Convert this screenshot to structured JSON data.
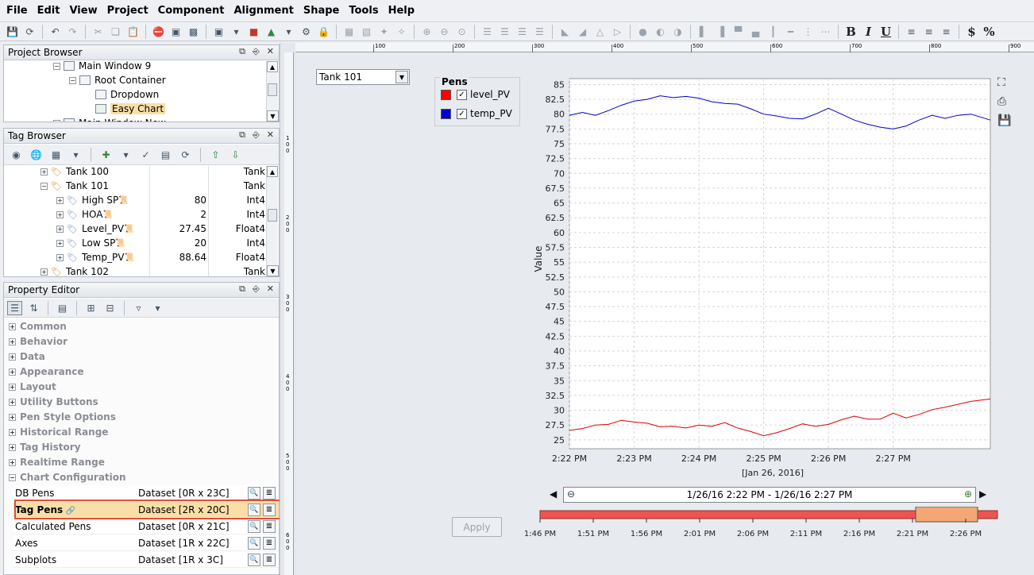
{
  "menu": [
    "File",
    "Edit",
    "View",
    "Project",
    "Component",
    "Alignment",
    "Shape",
    "Tools",
    "Help"
  ],
  "project_browser": {
    "title": "Project Browser",
    "items": [
      {
        "label": "Main Window 9",
        "level": 0,
        "icon": "window-icon"
      },
      {
        "label": "Root Container",
        "level": 1,
        "icon": "container-icon"
      },
      {
        "label": "Dropdown",
        "level": 2,
        "icon": "dropdown-icon"
      },
      {
        "label": "Easy Chart",
        "level": 2,
        "icon": "chart-icon",
        "selected": true
      },
      {
        "label": "Main Window New",
        "level": 0,
        "icon": "window-icon"
      }
    ]
  },
  "tag_browser": {
    "title": "Tag Browser",
    "rows": [
      {
        "label": "Tank 100",
        "value": "",
        "type": "Tank",
        "level": 0,
        "folder": true
      },
      {
        "label": "Tank 101",
        "value": "",
        "type": "Tank",
        "level": 0,
        "folder": true,
        "expanded": true
      },
      {
        "label": "High SP",
        "value": "80",
        "type": "Int4",
        "level": 1
      },
      {
        "label": "HOA",
        "value": "2",
        "type": "Int4",
        "level": 1
      },
      {
        "label": "Level_PV",
        "value": "27.45",
        "type": "Float4",
        "level": 1
      },
      {
        "label": "Low SP",
        "value": "20",
        "type": "Int4",
        "level": 1
      },
      {
        "label": "Temp_PV",
        "value": "88.64",
        "type": "Float4",
        "level": 1
      },
      {
        "label": "Tank 102",
        "value": "",
        "type": "Tank",
        "level": 0,
        "folder": true
      }
    ]
  },
  "property_editor": {
    "title": "Property Editor",
    "categories": [
      "Common",
      "Behavior",
      "Data",
      "Appearance",
      "Layout",
      "Utility Buttons",
      "Pen Style Options",
      "Historical Range",
      "Tag History",
      "Realtime Range"
    ],
    "open_category": "Chart Configuration",
    "properties": [
      {
        "name": "DB Pens",
        "value": "Dataset [0R x 23C]"
      },
      {
        "name": "Tag Pens",
        "value": "Dataset [2R x 20C]",
        "selected": true
      },
      {
        "name": "Calculated Pens",
        "value": "Dataset [0R x 21C]"
      },
      {
        "name": "Axes",
        "value": "Dataset [1R x 22C]"
      },
      {
        "name": "Subplots",
        "value": "Dataset [1R x 3C]"
      }
    ]
  },
  "ruler": {
    "h": [
      "100",
      "200",
      "300",
      "400",
      "500",
      "600",
      "700",
      "800",
      "900"
    ],
    "v": [
      "1\n0\n0",
      "2\n0\n0",
      "3\n0\n0",
      "4\n0\n0",
      "5\n0\n0",
      "6\n0\n0"
    ]
  },
  "dropdown": {
    "selected": "Tank 101"
  },
  "pens_legend": {
    "title": "Pens",
    "items": [
      {
        "name": "level_PV",
        "color": "#ff0000",
        "checked": true
      },
      {
        "name": "temp_PV",
        "color": "#0000cc",
        "checked": true
      }
    ]
  },
  "range_bar": {
    "text": "1/26/16 2:22 PM - 1/26/16 2:27 PM"
  },
  "apply_label": "Apply",
  "colors": {
    "selection_highlight": "#f9dfa7",
    "highlight_border": "#e34b3b",
    "overview_bar": "#ef5350",
    "overview_window": "#f4a774"
  },
  "chart_data": {
    "type": "line",
    "ylabel": "Value",
    "xlabel": "[Jan 26, 2016]",
    "ylim": [
      23.5,
      86
    ],
    "yticks": [
      25,
      27.5,
      30,
      32.5,
      35,
      37.5,
      40,
      42.5,
      45,
      47.5,
      50,
      52.5,
      55,
      57.5,
      60,
      62.5,
      65,
      67.5,
      70,
      72.5,
      75,
      77.5,
      80,
      82.5,
      85
    ],
    "xlim": [
      0,
      6.5
    ],
    "xticks": [
      {
        "label": "2:22 PM",
        "v": 0
      },
      {
        "label": "2:23 PM",
        "v": 1
      },
      {
        "label": "2:24 PM",
        "v": 2
      },
      {
        "label": "2:25 PM",
        "v": 3
      },
      {
        "label": "2:26 PM",
        "v": 4
      },
      {
        "label": "2:27 PM",
        "v": 5
      }
    ],
    "grid": true,
    "series": [
      {
        "name": "temp_PV",
        "color": "#0000cc",
        "x": [
          0,
          0.2,
          0.4,
          0.6,
          0.8,
          1.0,
          1.2,
          1.4,
          1.6,
          1.8,
          2.0,
          2.2,
          2.4,
          2.6,
          2.8,
          3.0,
          3.2,
          3.4,
          3.6,
          3.8,
          4.0,
          4.2,
          4.4,
          4.6,
          4.8,
          5.0,
          5.2,
          5.4,
          5.6,
          5.8,
          6.0,
          6.2,
          6.5
        ],
        "y": [
          79.8,
          80.3,
          79.8,
          80.6,
          81.5,
          82.2,
          82.5,
          83.1,
          82.8,
          83.0,
          82.7,
          82.1,
          81.8,
          81.7,
          80.9,
          80.0,
          79.7,
          79.3,
          79.2,
          80.0,
          81.0,
          80.0,
          79.0,
          78.3,
          77.8,
          77.5,
          78.0,
          79.0,
          79.8,
          79.3,
          79.8,
          80.0,
          79.0
        ]
      },
      {
        "name": "level_PV",
        "color": "#dd0000",
        "x": [
          0,
          0.2,
          0.4,
          0.6,
          0.8,
          1.0,
          1.2,
          1.4,
          1.6,
          1.8,
          2.0,
          2.2,
          2.4,
          2.6,
          2.8,
          3.0,
          3.2,
          3.4,
          3.6,
          3.8,
          4.0,
          4.2,
          4.4,
          4.6,
          4.8,
          5.0,
          5.2,
          5.4,
          5.6,
          5.8,
          6.0,
          6.2,
          6.5
        ],
        "y": [
          26.6,
          26.9,
          27.5,
          27.6,
          28.3,
          28.0,
          27.8,
          27.2,
          27.3,
          27.0,
          27.5,
          27.3,
          27.9,
          27.0,
          26.4,
          25.7,
          26.2,
          26.9,
          27.7,
          27.3,
          27.6,
          28.4,
          29.0,
          28.5,
          28.5,
          29.5,
          28.7,
          29.3,
          30.1,
          30.5,
          31.0,
          31.5,
          31.9
        ]
      }
    ]
  },
  "overview": {
    "ticks": [
      "1:46 PM",
      "1:51 PM",
      "1:56 PM",
      "2:01 PM",
      "2:06 PM",
      "2:11 PM",
      "2:16 PM",
      "2:21 PM",
      "2:26 PM"
    ]
  }
}
